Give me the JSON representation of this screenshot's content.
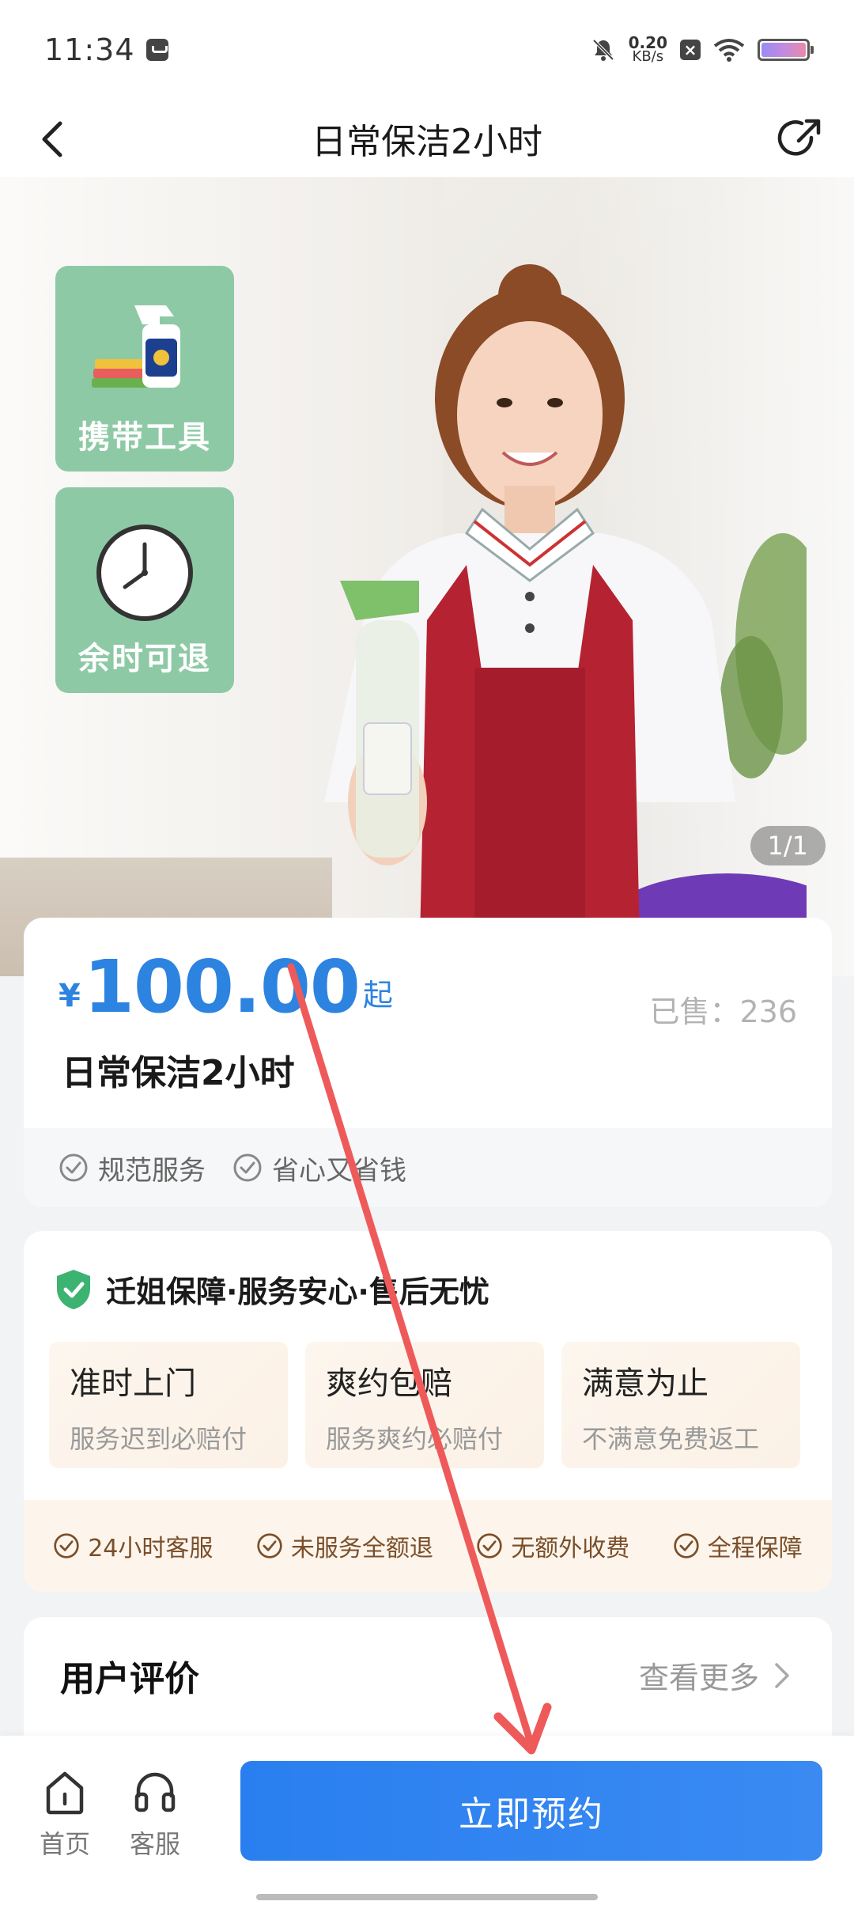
{
  "status_bar": {
    "time": "11:34",
    "net_speed_value": "0.20",
    "net_speed_unit": "KB/s"
  },
  "nav": {
    "title": "日常保洁2小时"
  },
  "hero": {
    "badges": [
      {
        "label": "携带工具",
        "icon": "spray-bottle-icon"
      },
      {
        "label": "余时可退",
        "icon": "clock-icon"
      }
    ],
    "counter": "1/1"
  },
  "product": {
    "currency": "¥",
    "price": "100.00",
    "price_suffix": "起",
    "sold_label": "已售：236",
    "name": "日常保洁2小时",
    "tags": [
      "规范服务",
      "省心又省钱"
    ]
  },
  "guarantee": {
    "title": "迁姐保障·服务安心·售后无忧",
    "items": [
      {
        "title": "准时上门",
        "sub": "服务迟到必赔付"
      },
      {
        "title": "爽约包赔",
        "sub": "服务爽约必赔付"
      },
      {
        "title": "满意为止",
        "sub": "不满意免费返工"
      }
    ],
    "points": [
      "24小时客服",
      "未服务全额退",
      "无额外收费",
      "全程保障"
    ]
  },
  "reviews": {
    "title": "用户评价",
    "more": "查看更多"
  },
  "bottom": {
    "home_label": "首页",
    "service_label": "客服",
    "book_label": "立即预约"
  },
  "colors": {
    "accent": "#2d83e0",
    "button": "#2a7ff0",
    "badge_green": "#8ec9a6",
    "guarantee_brown": "#7a4f2a",
    "overlay_arrow": "#ee5a5a"
  }
}
